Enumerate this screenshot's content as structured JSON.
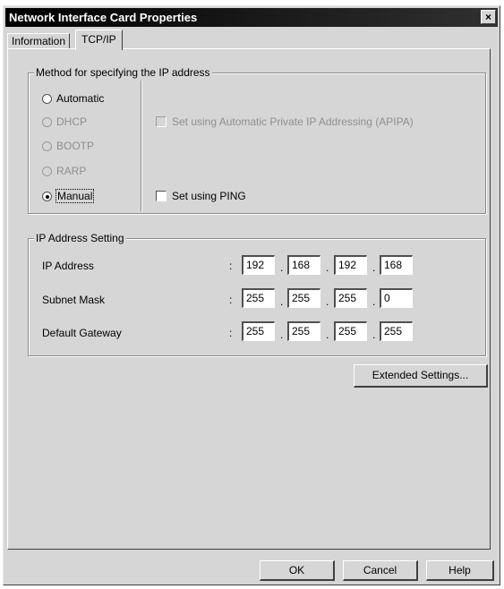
{
  "window": {
    "title": "Network Interface Card Properties",
    "close_glyph": "×"
  },
  "tabs": [
    {
      "label": "Information",
      "active": false
    },
    {
      "label": "TCP/IP",
      "active": true
    }
  ],
  "ip_method": {
    "legend": "Method for specifying the IP address",
    "options": [
      {
        "label": "Automatic",
        "enabled": true,
        "selected": false
      },
      {
        "label": "DHCP",
        "enabled": false,
        "selected": false
      },
      {
        "label": "BOOTP",
        "enabled": false,
        "selected": false
      },
      {
        "label": "RARP",
        "enabled": false,
        "selected": false
      },
      {
        "label": "Manual",
        "enabled": true,
        "selected": true
      }
    ],
    "apipa_label": "Set using Automatic Private IP Addressing (APIPA)",
    "apipa_enabled": false,
    "apipa_checked": false,
    "ping_label": "Set using PING",
    "ping_checked": false
  },
  "ip_settings": {
    "legend": "IP Address Setting",
    "separator": ":",
    "dot": ".",
    "rows": [
      {
        "label": "IP Address",
        "octets": [
          "192",
          "168",
          "192",
          "168"
        ]
      },
      {
        "label": "Subnet Mask",
        "octets": [
          "255",
          "255",
          "255",
          "0"
        ]
      },
      {
        "label": "Default Gateway",
        "octets": [
          "255",
          "255",
          "255",
          "255"
        ]
      }
    ]
  },
  "buttons": {
    "extended": "Extended Settings...",
    "ok": "OK",
    "cancel": "Cancel",
    "help": "Help"
  },
  "colors": {
    "face": "#d6d6d6",
    "titlebar": "#000000",
    "disabled_text": "#8f8f8f"
  }
}
